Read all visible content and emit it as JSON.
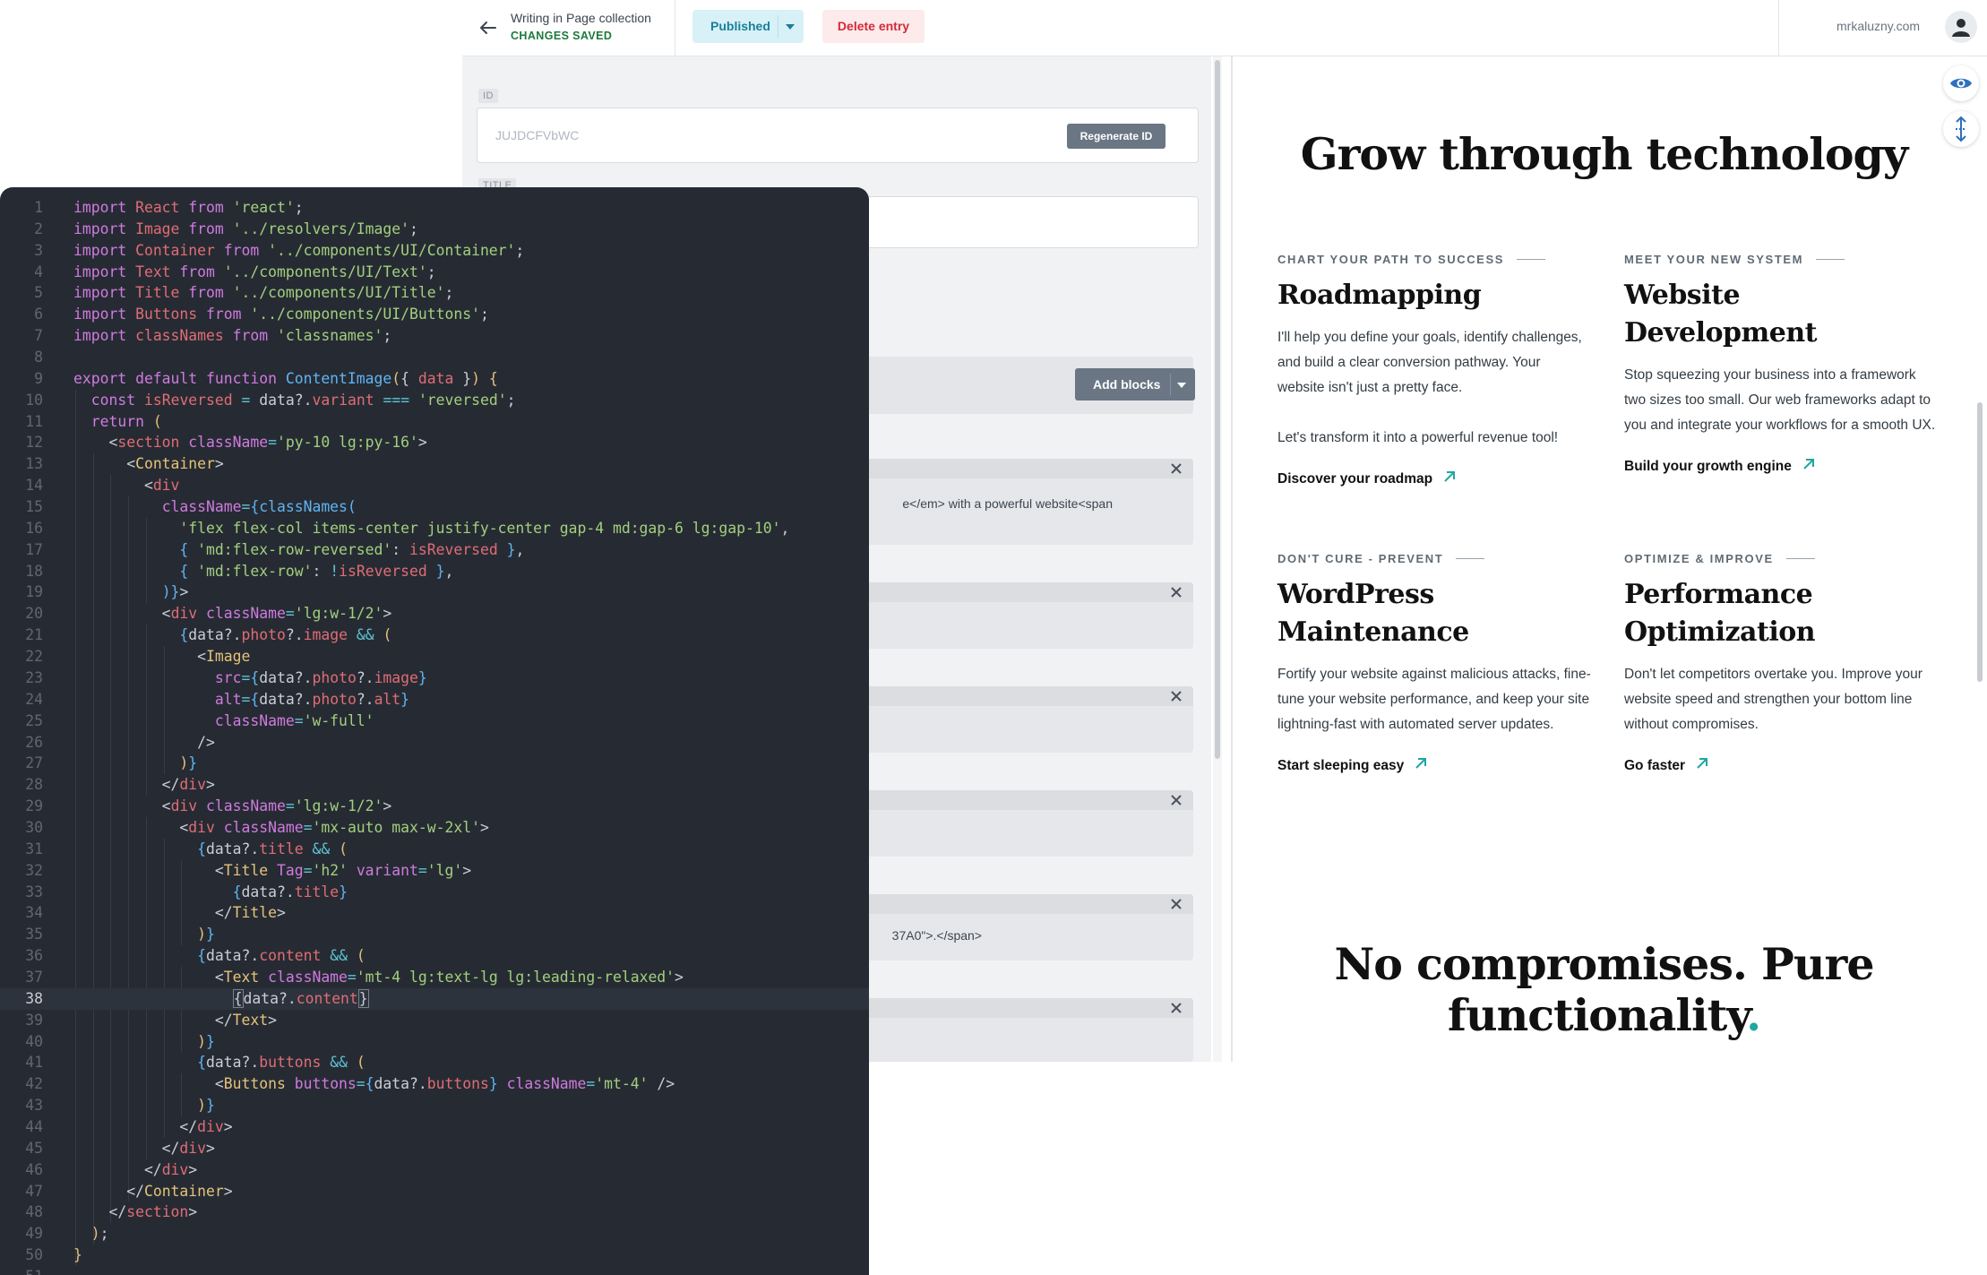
{
  "header": {
    "collection_title": "Writing in Page collection",
    "save_status": "CHANGES SAVED",
    "publish_label": "Published",
    "delete_label": "Delete entry",
    "user_name": "mrkaluzny.com"
  },
  "form": {
    "id_label": "ID",
    "id_value": "JUJDCFVbWC",
    "regenerate_label": "Regenerate ID",
    "title_label": "TITLE",
    "add_blocks_label": "Add blocks",
    "blocks": [
      {
        "text": "e</em> with a powerful website<span"
      },
      {
        "text": ""
      },
      {
        "text": ""
      },
      {
        "text": ""
      },
      {
        "text": "37A0\">.</span>"
      },
      {
        "text": ""
      }
    ]
  },
  "preview": {
    "heading": "Grow through technology",
    "features": [
      {
        "eyebrow": "CHART YOUR PATH TO SUCCESS",
        "title": "Roadmapping",
        "body1": "I'll help you define your goals, identify challenges, and build a clear conversion pathway. Your website isn't just a pretty face.",
        "body2": "Let's transform it into a powerful revenue tool!",
        "link": "Discover your roadmap"
      },
      {
        "eyebrow": "MEET YOUR NEW SYSTEM",
        "title": "Website Development",
        "body1": "Stop squeezing your business into a framework two sizes too small. Our web frameworks adapt to you and integrate your workflows for a smooth UX.",
        "body2": "",
        "link": "Build your growth engine"
      },
      {
        "eyebrow": "DON'T CURE - PREVENT",
        "title": "WordPress Maintenance",
        "body1": "Fortify your website against malicious attacks, fine-tune your website performance, and keep your site lightning-fast with automated server updates.",
        "body2": "",
        "link": "Start sleeping easy"
      },
      {
        "eyebrow": "OPTIMIZE & IMPROVE",
        "title": "Performance Optimization",
        "body1": "Don't let competitors overtake you. Improve your website speed and strengthen your bottom line without compromises.",
        "body2": "",
        "link": "Go faster"
      }
    ],
    "heading2_line1": "No compromises. Pure",
    "heading2_line2": "functionality",
    "heading2_dot": "."
  },
  "editor": {
    "active_line": 38,
    "lines": [
      [
        [
          "kw",
          "import "
        ],
        [
          "id",
          "React "
        ],
        [
          "kw",
          "from "
        ],
        [
          "str",
          "'react'"
        ],
        [
          "pl",
          ";"
        ]
      ],
      [
        [
          "kw",
          "import "
        ],
        [
          "id",
          "Image "
        ],
        [
          "kw",
          "from "
        ],
        [
          "str",
          "'../resolvers/Image'"
        ],
        [
          "pl",
          ";"
        ]
      ],
      [
        [
          "kw",
          "import "
        ],
        [
          "id",
          "Container "
        ],
        [
          "kw",
          "from "
        ],
        [
          "str",
          "'../components/UI/Container'"
        ],
        [
          "pl",
          ";"
        ]
      ],
      [
        [
          "kw",
          "import "
        ],
        [
          "id",
          "Text "
        ],
        [
          "kw",
          "from "
        ],
        [
          "str",
          "'../components/UI/Text'"
        ],
        [
          "pl",
          ";"
        ]
      ],
      [
        [
          "kw",
          "import "
        ],
        [
          "id",
          "Title "
        ],
        [
          "kw",
          "from "
        ],
        [
          "str",
          "'../components/UI/Title'"
        ],
        [
          "pl",
          ";"
        ]
      ],
      [
        [
          "kw",
          "import "
        ],
        [
          "id",
          "Buttons "
        ],
        [
          "kw",
          "from "
        ],
        [
          "str",
          "'../components/UI/Buttons'"
        ],
        [
          "pl",
          ";"
        ]
      ],
      [
        [
          "kw",
          "import "
        ],
        [
          "id",
          "classNames "
        ],
        [
          "kw",
          "from "
        ],
        [
          "str",
          "'classnames'"
        ],
        [
          "pl",
          ";"
        ]
      ],
      [],
      [
        [
          "kw",
          "export default function "
        ],
        [
          "fn",
          "ContentImage"
        ],
        [
          "br",
          "("
        ],
        [
          "pl",
          "{ "
        ],
        [
          "id",
          "data"
        ],
        [
          "pl",
          " }"
        ],
        [
          "br",
          ")"
        ],
        [
          "pl",
          " "
        ],
        [
          "br",
          "{"
        ]
      ],
      [
        [
          "pl",
          "  "
        ],
        [
          "kw",
          "const "
        ],
        [
          "id",
          "isReversed "
        ],
        [
          "op",
          "= "
        ],
        [
          "pl",
          "data?."
        ],
        [
          "id",
          "variant "
        ],
        [
          "op",
          "=== "
        ],
        [
          "str",
          "'reversed'"
        ],
        [
          "pl",
          ";"
        ]
      ],
      [
        [
          "pl",
          "  "
        ],
        [
          "kw",
          "return "
        ],
        [
          "br",
          "("
        ]
      ],
      [
        [
          "pl",
          "    <"
        ],
        [
          "id",
          "section "
        ],
        [
          "attr",
          "className"
        ],
        [
          "op",
          "="
        ],
        [
          "str",
          "'py-10 lg:py-16'"
        ],
        [
          "pl",
          ">"
        ]
      ],
      [
        [
          "pl",
          "      <"
        ],
        [
          "tag",
          "Container"
        ],
        [
          "pl",
          ">"
        ]
      ],
      [
        [
          "pl",
          "        <"
        ],
        [
          "id",
          "div"
        ]
      ],
      [
        [
          "pl",
          "          "
        ],
        [
          "attr",
          "className"
        ],
        [
          "op",
          "="
        ],
        [
          "fn",
          "{classNames("
        ]
      ],
      [
        [
          "pl",
          "            "
        ],
        [
          "str",
          "'flex flex-col items-center justify-center gap-4 md:gap-6 lg:gap-10'"
        ],
        [
          "pl",
          ","
        ]
      ],
      [
        [
          "pl",
          "            "
        ],
        [
          "fn",
          "{ "
        ],
        [
          "str",
          "'md:flex-row-reversed'"
        ],
        [
          "pl",
          ": "
        ],
        [
          "id",
          "isReversed"
        ],
        [
          "fn",
          " }"
        ],
        [
          "pl",
          ","
        ]
      ],
      [
        [
          "pl",
          "            "
        ],
        [
          "fn",
          "{ "
        ],
        [
          "str",
          "'md:flex-row'"
        ],
        [
          "pl",
          ": "
        ],
        [
          "op",
          "!"
        ],
        [
          "id",
          "isReversed"
        ],
        [
          "fn",
          " }"
        ],
        [
          "pl",
          ","
        ]
      ],
      [
        [
          "pl",
          "          "
        ],
        [
          "fn",
          ")}"
        ],
        [
          "pl",
          ">"
        ]
      ],
      [
        [
          "pl",
          "          <"
        ],
        [
          "id",
          "div "
        ],
        [
          "attr",
          "className"
        ],
        [
          "op",
          "="
        ],
        [
          "str",
          "'lg:w-1/2'"
        ],
        [
          "pl",
          ">"
        ]
      ],
      [
        [
          "pl",
          "            "
        ],
        [
          "fn",
          "{"
        ],
        [
          "pl",
          "data?."
        ],
        [
          "id",
          "photo"
        ],
        [
          "pl",
          "?."
        ],
        [
          "id",
          "image "
        ],
        [
          "op",
          "&& "
        ],
        [
          "br",
          "("
        ]
      ],
      [
        [
          "pl",
          "              <"
        ],
        [
          "tag",
          "Image"
        ]
      ],
      [
        [
          "pl",
          "                "
        ],
        [
          "attr",
          "src"
        ],
        [
          "op",
          "="
        ],
        [
          "fn",
          "{"
        ],
        [
          "pl",
          "data?."
        ],
        [
          "id",
          "photo"
        ],
        [
          "pl",
          "?."
        ],
        [
          "id",
          "image"
        ],
        [
          "fn",
          "}"
        ]
      ],
      [
        [
          "pl",
          "                "
        ],
        [
          "attr",
          "alt"
        ],
        [
          "op",
          "="
        ],
        [
          "fn",
          "{"
        ],
        [
          "pl",
          "data?."
        ],
        [
          "id",
          "photo"
        ],
        [
          "pl",
          "?."
        ],
        [
          "id",
          "alt"
        ],
        [
          "fn",
          "}"
        ]
      ],
      [
        [
          "pl",
          "                "
        ],
        [
          "attr",
          "className"
        ],
        [
          "op",
          "="
        ],
        [
          "str",
          "'w-full'"
        ]
      ],
      [
        [
          "pl",
          "              />"
        ]
      ],
      [
        [
          "pl",
          "            "
        ],
        [
          "br",
          ")"
        ],
        [
          "fn",
          "}"
        ]
      ],
      [
        [
          "pl",
          "          </"
        ],
        [
          "id",
          "div"
        ],
        [
          "pl",
          ">"
        ]
      ],
      [
        [
          "pl",
          "          <"
        ],
        [
          "id",
          "div "
        ],
        [
          "attr",
          "className"
        ],
        [
          "op",
          "="
        ],
        [
          "str",
          "'lg:w-1/2'"
        ],
        [
          "pl",
          ">"
        ]
      ],
      [
        [
          "pl",
          "            <"
        ],
        [
          "id",
          "div "
        ],
        [
          "attr",
          "className"
        ],
        [
          "op",
          "="
        ],
        [
          "str",
          "'mx-auto max-w-2xl'"
        ],
        [
          "pl",
          ">"
        ]
      ],
      [
        [
          "pl",
          "              "
        ],
        [
          "fn",
          "{"
        ],
        [
          "pl",
          "data?."
        ],
        [
          "id",
          "title "
        ],
        [
          "op",
          "&& "
        ],
        [
          "br",
          "("
        ]
      ],
      [
        [
          "pl",
          "                <"
        ],
        [
          "tag",
          "Title "
        ],
        [
          "attr",
          "Tag"
        ],
        [
          "op",
          "="
        ],
        [
          "str",
          "'h2' "
        ],
        [
          "attr",
          "variant"
        ],
        [
          "op",
          "="
        ],
        [
          "str",
          "'lg'"
        ],
        [
          "pl",
          ">"
        ]
      ],
      [
        [
          "pl",
          "                  "
        ],
        [
          "fn",
          "{"
        ],
        [
          "pl",
          "data?."
        ],
        [
          "id",
          "title"
        ],
        [
          "fn",
          "}"
        ]
      ],
      [
        [
          "pl",
          "                </"
        ],
        [
          "tag",
          "Title"
        ],
        [
          "pl",
          ">"
        ]
      ],
      [
        [
          "pl",
          "              "
        ],
        [
          "br",
          ")"
        ],
        [
          "fn",
          "}"
        ]
      ],
      [
        [
          "pl",
          "              "
        ],
        [
          "fn",
          "{"
        ],
        [
          "pl",
          "data?."
        ],
        [
          "id",
          "content "
        ],
        [
          "op",
          "&& "
        ],
        [
          "br",
          "("
        ]
      ],
      [
        [
          "pl",
          "                <"
        ],
        [
          "tag",
          "Text "
        ],
        [
          "attr",
          "className"
        ],
        [
          "op",
          "="
        ],
        [
          "str",
          "'mt-4 lg:text-lg lg:leading-relaxed'"
        ],
        [
          "pl",
          ">"
        ]
      ],
      [
        [
          "pl",
          "                  "
        ],
        [
          "cur",
          "{"
        ],
        [
          "pl",
          "data?."
        ],
        [
          "id",
          "content"
        ],
        [
          "cur",
          "}"
        ]
      ],
      [
        [
          "pl",
          "                </"
        ],
        [
          "tag",
          "Text"
        ],
        [
          "pl",
          ">"
        ]
      ],
      [
        [
          "pl",
          "              "
        ],
        [
          "br",
          ")"
        ],
        [
          "fn",
          "}"
        ]
      ],
      [
        [
          "pl",
          "              "
        ],
        [
          "fn",
          "{"
        ],
        [
          "pl",
          "data?."
        ],
        [
          "id",
          "buttons "
        ],
        [
          "op",
          "&& "
        ],
        [
          "br",
          "("
        ]
      ],
      [
        [
          "pl",
          "                <"
        ],
        [
          "tag",
          "Buttons "
        ],
        [
          "attr",
          "buttons"
        ],
        [
          "op",
          "="
        ],
        [
          "fn",
          "{"
        ],
        [
          "pl",
          "data?."
        ],
        [
          "id",
          "buttons"
        ],
        [
          "fn",
          "} "
        ],
        [
          "attr",
          "className"
        ],
        [
          "op",
          "="
        ],
        [
          "str",
          "'mt-4'"
        ],
        [
          "pl",
          " />"
        ]
      ],
      [
        [
          "pl",
          "              "
        ],
        [
          "br",
          ")"
        ],
        [
          "fn",
          "}"
        ]
      ],
      [
        [
          "pl",
          "            </"
        ],
        [
          "id",
          "div"
        ],
        [
          "pl",
          ">"
        ]
      ],
      [
        [
          "pl",
          "          </"
        ],
        [
          "id",
          "div"
        ],
        [
          "pl",
          ">"
        ]
      ],
      [
        [
          "pl",
          "        </"
        ],
        [
          "id",
          "div"
        ],
        [
          "pl",
          ">"
        ]
      ],
      [
        [
          "pl",
          "      </"
        ],
        [
          "tag",
          "Container"
        ],
        [
          "pl",
          ">"
        ]
      ],
      [
        [
          "pl",
          "    </"
        ],
        [
          "id",
          "section"
        ],
        [
          "pl",
          ">"
        ]
      ],
      [
        [
          "pl",
          "  "
        ],
        [
          "br",
          ")"
        ],
        [
          "pl",
          ";"
        ]
      ],
      [
        [
          "br",
          "}"
        ]
      ],
      []
    ]
  }
}
